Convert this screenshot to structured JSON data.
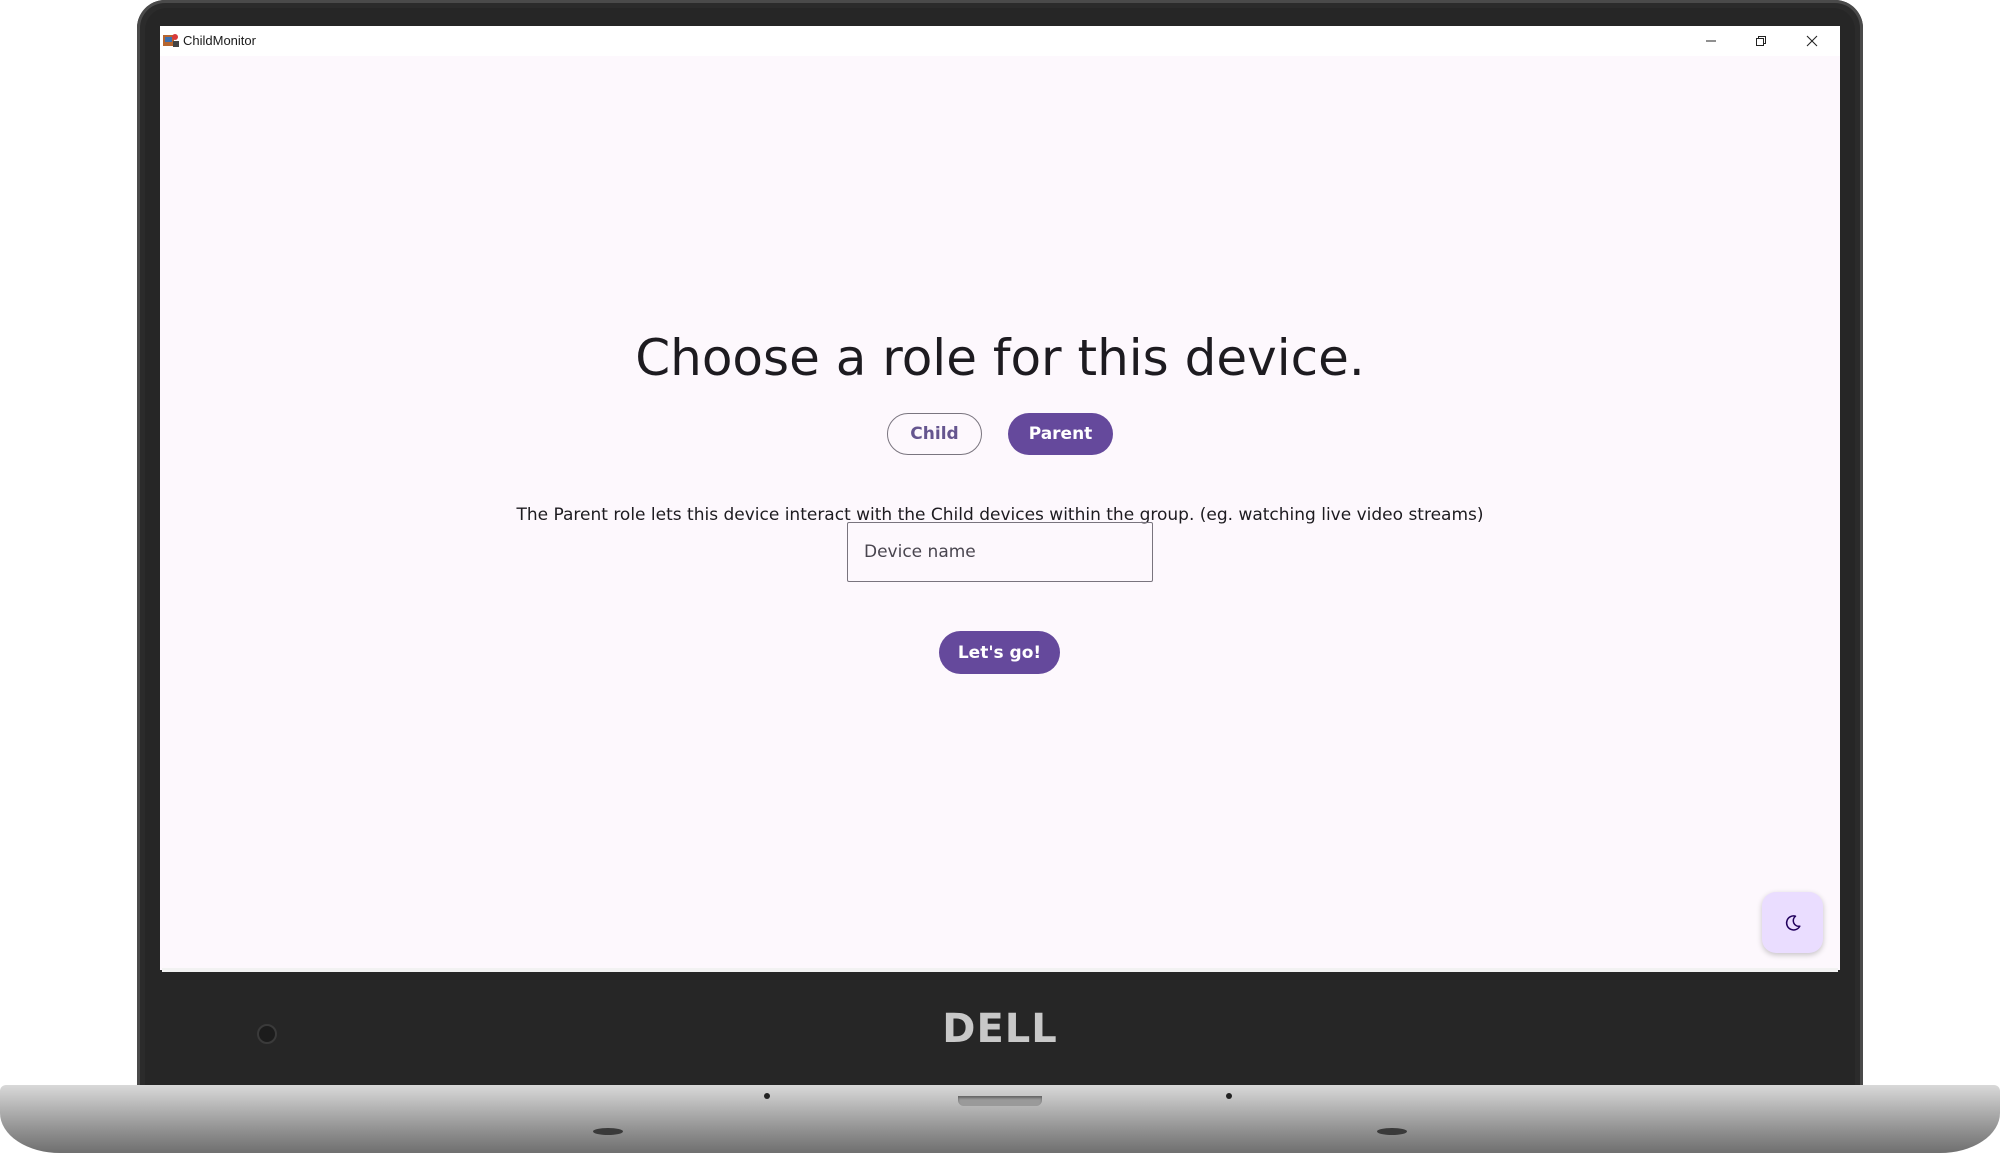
{
  "window": {
    "title": "ChildMonitor",
    "app_icon": "childmonitor-app-icon",
    "controls": {
      "minimize_icon": "minimize-icon",
      "restore_icon": "restore-icon",
      "close_icon": "close-icon"
    }
  },
  "main": {
    "heading": "Choose a role for this device.",
    "roles": [
      {
        "label": "Child",
        "selected": false
      },
      {
        "label": "Parent",
        "selected": true
      }
    ],
    "description": "The Parent role lets this device interact with the Child devices within the group. (eg. watching live video streams)",
    "device_name": {
      "placeholder": "Device name",
      "value": ""
    },
    "submit_label": "Let's go!"
  },
  "theme_toggle": {
    "icon": "moon-icon"
  },
  "device_frame": {
    "brand": "DELL"
  },
  "colors": {
    "primary": "#65499c",
    "background": "#fdf8fd",
    "fab_background": "#eaddff",
    "outline": "#79747e",
    "on_surface": "#1d1b20"
  }
}
